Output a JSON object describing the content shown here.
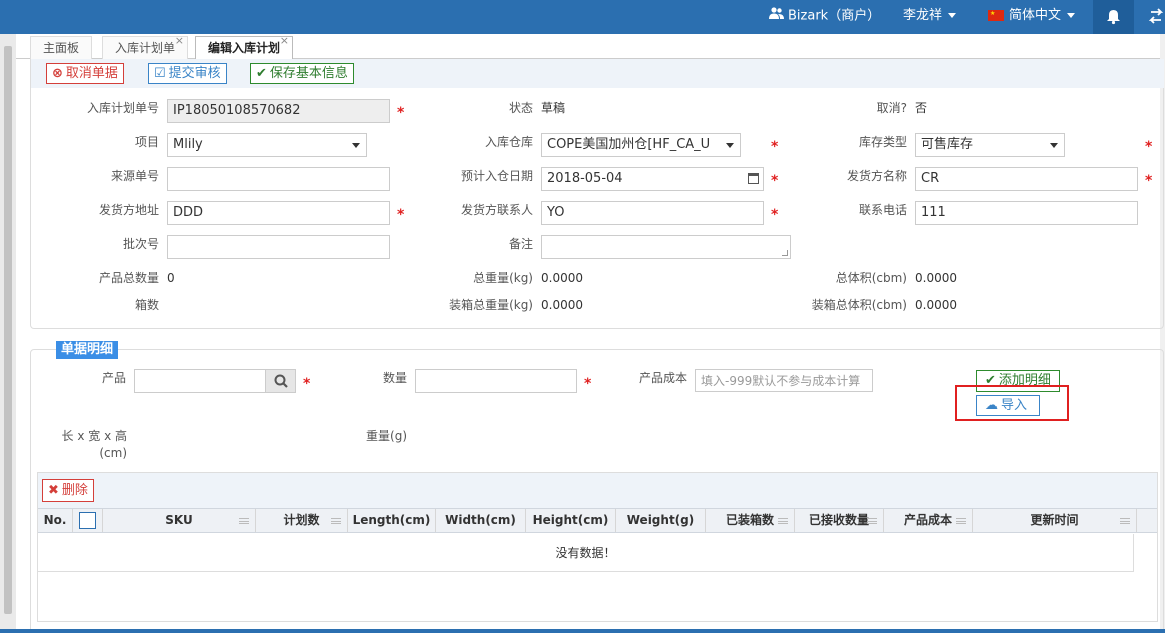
{
  "topbar": {
    "org": "Bizark（商户）",
    "user": "李龙祥",
    "language": "简体中文",
    "icons": {
      "org": "users-icon",
      "flag": "china-flag-icon",
      "bell": "bell-icon",
      "swap": "swap-icon"
    },
    "color": "#2b6fb0"
  },
  "tabs": [
    {
      "label": "主面板",
      "closable": false
    },
    {
      "label": "入库计划单",
      "closable": true
    },
    {
      "label": "编辑入库计划",
      "closable": true,
      "active": true
    }
  ],
  "toolbar": {
    "cancel_label": "取消单据",
    "submit_label": "提交审核",
    "save_label": "保存基本信息"
  },
  "form": {
    "plan_no": {
      "label": "入库计划单号",
      "value": "IP18050108570682"
    },
    "status": {
      "label": "状态",
      "value": "草稿"
    },
    "cancelled": {
      "label": "取消?",
      "value": "否"
    },
    "project": {
      "label": "项目",
      "value": "Mlily"
    },
    "warehouse": {
      "label": "入库仓库",
      "value": "COPE美国加州仓[HF_CA_U"
    },
    "stock_type": {
      "label": "库存类型",
      "value": "可售库存"
    },
    "source_no": {
      "label": "来源单号",
      "value": ""
    },
    "eta": {
      "label": "预计入仓日期",
      "value": "2018-05-04"
    },
    "shipper_name": {
      "label": "发货方名称",
      "value": "CR"
    },
    "shipper_address": {
      "label": "发货方地址",
      "value": "DDD"
    },
    "shipper_contact": {
      "label": "发货方联系人",
      "value": "YO"
    },
    "phone": {
      "label": "联系电话",
      "value": "111"
    },
    "batch_no": {
      "label": "批次号",
      "value": ""
    },
    "remark": {
      "label": "备注",
      "value": ""
    },
    "total_qty": {
      "label": "产品总数量",
      "value": "0"
    },
    "total_weight": {
      "label": "总重量(kg)",
      "value": "0.0000"
    },
    "total_volume": {
      "label": "总体积(cbm)",
      "value": "0.0000"
    },
    "cartons": {
      "label": "箱数",
      "value": ""
    },
    "packed_weight": {
      "label": "装箱总重量(kg)",
      "value": "0.0000"
    },
    "packed_volume": {
      "label": "装箱总体积(cbm)",
      "value": "0.0000"
    },
    "required_mark": "*"
  },
  "detail": {
    "legend": "单据明细",
    "product_label": "产品",
    "qty_label": "数量",
    "cost_label": "产品成本",
    "cost_placeholder": "填入-999默认不参与成本计算",
    "add_label": "添加明细",
    "import_label": "导入",
    "dims_label": "长 x 宽 x 高",
    "dims_unit": "(cm)",
    "weight_label": "重量(g)"
  },
  "table": {
    "delete_label": "删除",
    "columns": [
      "No.",
      "",
      "SKU",
      "计划数",
      "Length(cm)",
      "Width(cm)",
      "Height(cm)",
      "Weight(g)",
      "已装箱数",
      "已接收数量",
      "产品成本",
      "更新时间"
    ],
    "empty_text": "没有数据！"
  }
}
